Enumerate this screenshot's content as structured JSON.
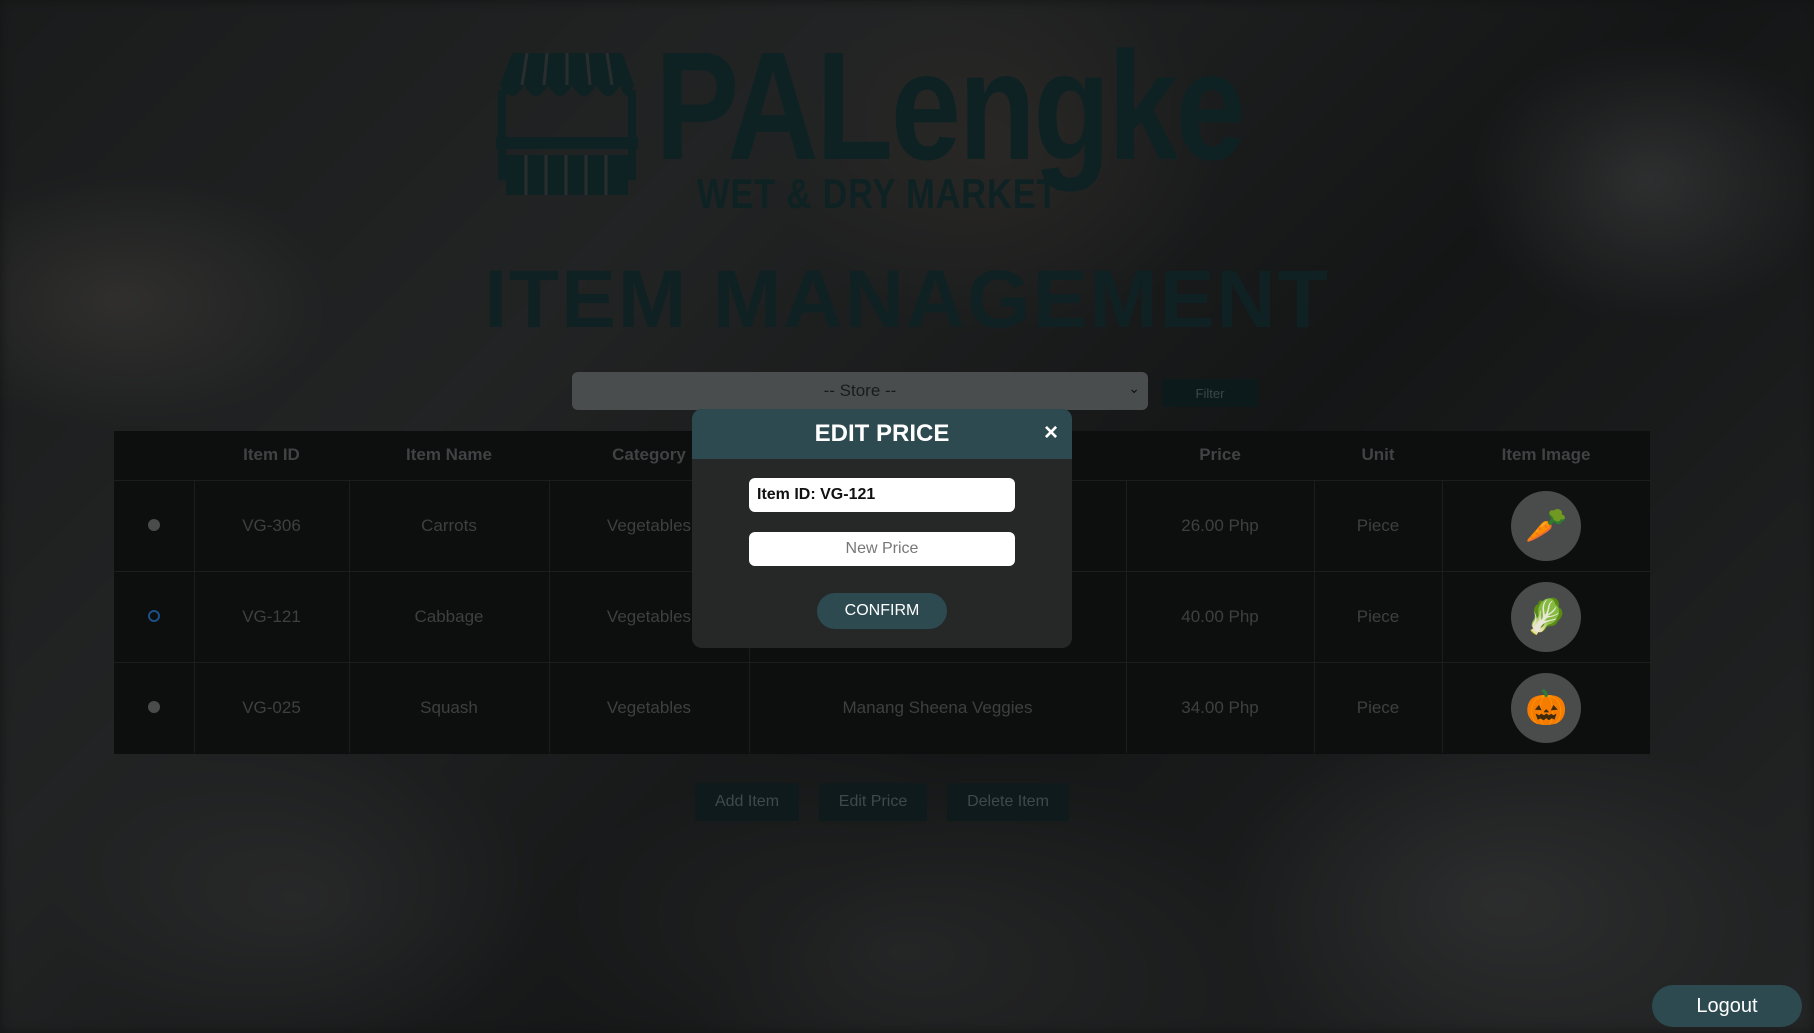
{
  "brand": {
    "name": "PALengke",
    "tagline": "WET & DRY MARKET"
  },
  "page": {
    "title": "ITEM MANAGEMENT"
  },
  "filter": {
    "store_placeholder": "-- Store --",
    "filter_label": "Filter"
  },
  "table": {
    "headers": [
      "",
      "Item ID",
      "Item Name",
      "Category",
      "",
      "Price",
      "Unit",
      "Item Image"
    ],
    "rows": [
      {
        "selected": false,
        "id": "VG-306",
        "name": "Carrots",
        "category": "Vegetables",
        "store": "",
        "price": "26.00 Php",
        "unit": "Piece",
        "image_icon": "carrot-icon"
      },
      {
        "selected": true,
        "id": "VG-121",
        "name": "Cabbage",
        "category": "Vegetables",
        "store": "",
        "price": "40.00 Php",
        "unit": "Piece",
        "image_icon": "cabbage-icon"
      },
      {
        "selected": false,
        "id": "VG-025",
        "name": "Squash",
        "category": "Vegetables",
        "store": "Manang Sheena Veggies",
        "price": "34.00 Php",
        "unit": "Piece",
        "image_icon": "squash-icon"
      }
    ]
  },
  "actions": {
    "add_label": "Add Item",
    "edit_label": "Edit Price",
    "delete_label": "Delete Item"
  },
  "modal": {
    "title": "EDIT PRICE",
    "close_glyph": "×",
    "item_id_text": "Item ID: VG-121",
    "price_placeholder": "New Price",
    "price_value": "",
    "confirm_label": "CONFIRM"
  },
  "logout_label": "Logout",
  "colors": {
    "accent": "#2c4a50",
    "brand_dark": "#0e2224"
  }
}
